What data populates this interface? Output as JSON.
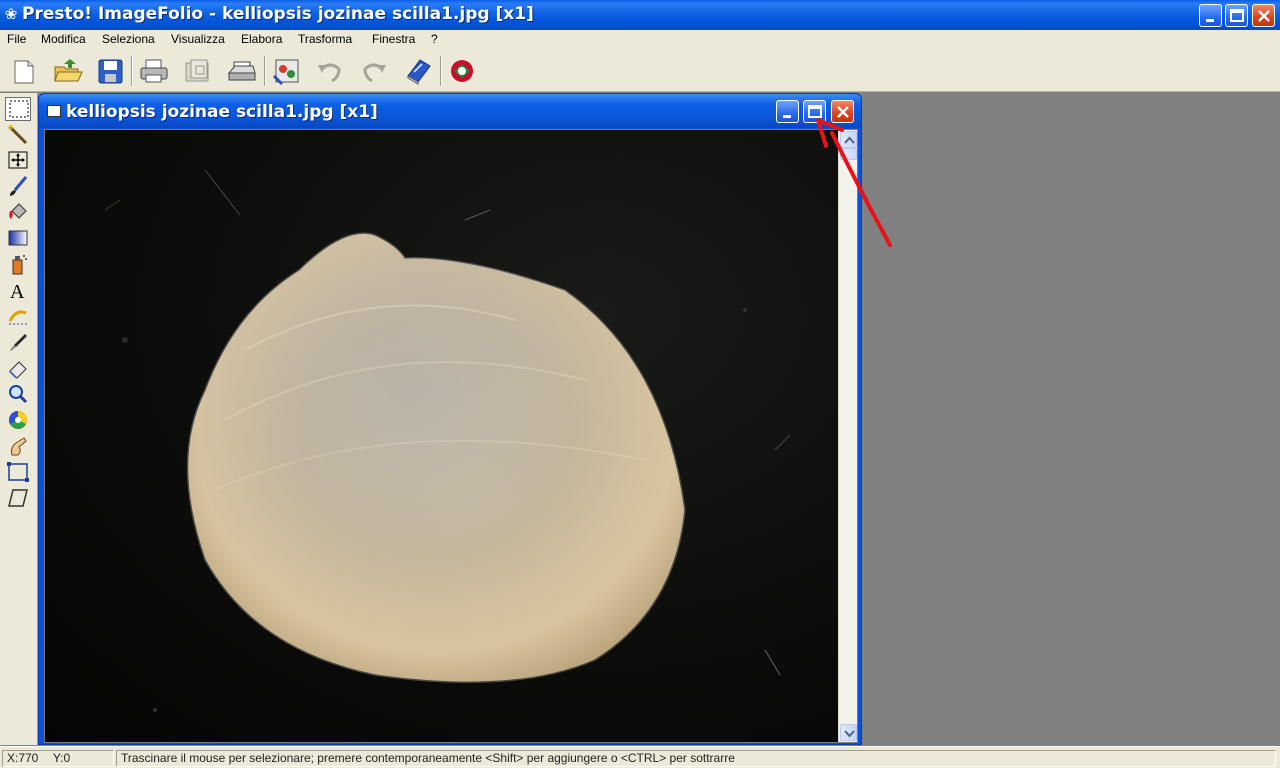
{
  "app": {
    "title": "Presto! ImageFolio - kelliopsis jozinae scilla1.jpg [x1]"
  },
  "menu": {
    "items": [
      "File",
      "Modifica",
      "Seleziona",
      "Visualizza",
      "Elabora",
      "Trasforma",
      "Finestra",
      "?"
    ]
  },
  "toolbar": {
    "buttons": [
      "new-document-icon",
      "open-folder-icon",
      "save-icon",
      "print-icon",
      "print-preview-icon",
      "scan-icon",
      "acquire-icon",
      "undo-icon",
      "redo-icon",
      "help-book-icon",
      "exit-icon"
    ]
  },
  "palette": {
    "tools": [
      "rectangle-select-icon",
      "magic-wand-icon",
      "move-icon",
      "brush-icon",
      "fill-icon",
      "gradient-icon",
      "spray-icon",
      "text-icon",
      "clone-icon",
      "eyedropper-icon",
      "eraser-icon",
      "zoom-icon",
      "color-icon",
      "smudge-icon",
      "crop-icon",
      "perspective-icon"
    ],
    "selected": "rectangle-select-icon"
  },
  "document": {
    "title": "kelliopsis jozinae scilla1.jpg [x1]"
  },
  "statusbar": {
    "x": "X:770",
    "y": "Y:0",
    "message": "Trascinare il mouse per selezionare; premere contemporaneamente <Shift> per aggiungere o <CTRL> per sottrarre"
  },
  "colors": {
    "titlebar": "#0b5fe0",
    "chrome": "#ece9d8",
    "workspace": "#808080",
    "annotation": "#e8121a"
  }
}
